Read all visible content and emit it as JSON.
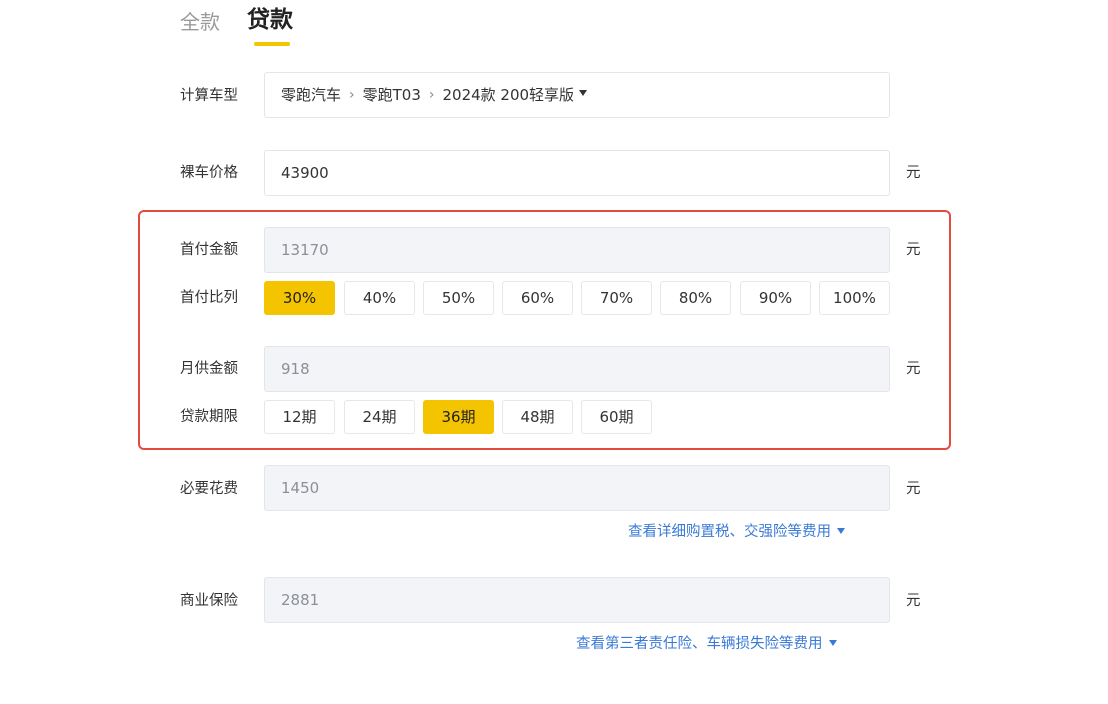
{
  "tabs": {
    "full": "全款",
    "loan": "贷款"
  },
  "model": {
    "label": "计算车型",
    "brand": "零跑汽车",
    "series": "零跑T03",
    "trim": "2024款 200轻享版"
  },
  "price": {
    "label": "裸车价格",
    "value": "43900",
    "unit": "元"
  },
  "down_payment": {
    "label": "首付金额",
    "value": "13170",
    "unit": "元"
  },
  "down_ratio": {
    "label": "首付比列",
    "options": [
      "30%",
      "40%",
      "50%",
      "60%",
      "70%",
      "80%",
      "90%",
      "100%"
    ],
    "selected": "30%"
  },
  "monthly": {
    "label": "月供金额",
    "value": "918",
    "unit": "元"
  },
  "term": {
    "label": "贷款期限",
    "options": [
      "12期",
      "24期",
      "36期",
      "48期",
      "60期"
    ],
    "selected": "36期"
  },
  "necessary_fees": {
    "label": "必要花费",
    "value": "1450",
    "unit": "元",
    "link": "查看详细购置税、交强险等费用"
  },
  "commercial_insurance": {
    "label": "商业保险",
    "value": "2881",
    "unit": "元",
    "link": "查看第三者责任险、车辆损失险等费用"
  },
  "colors": {
    "accent": "#f5c400",
    "highlight_box": "#e34b3f",
    "link": "#3a79d6"
  }
}
